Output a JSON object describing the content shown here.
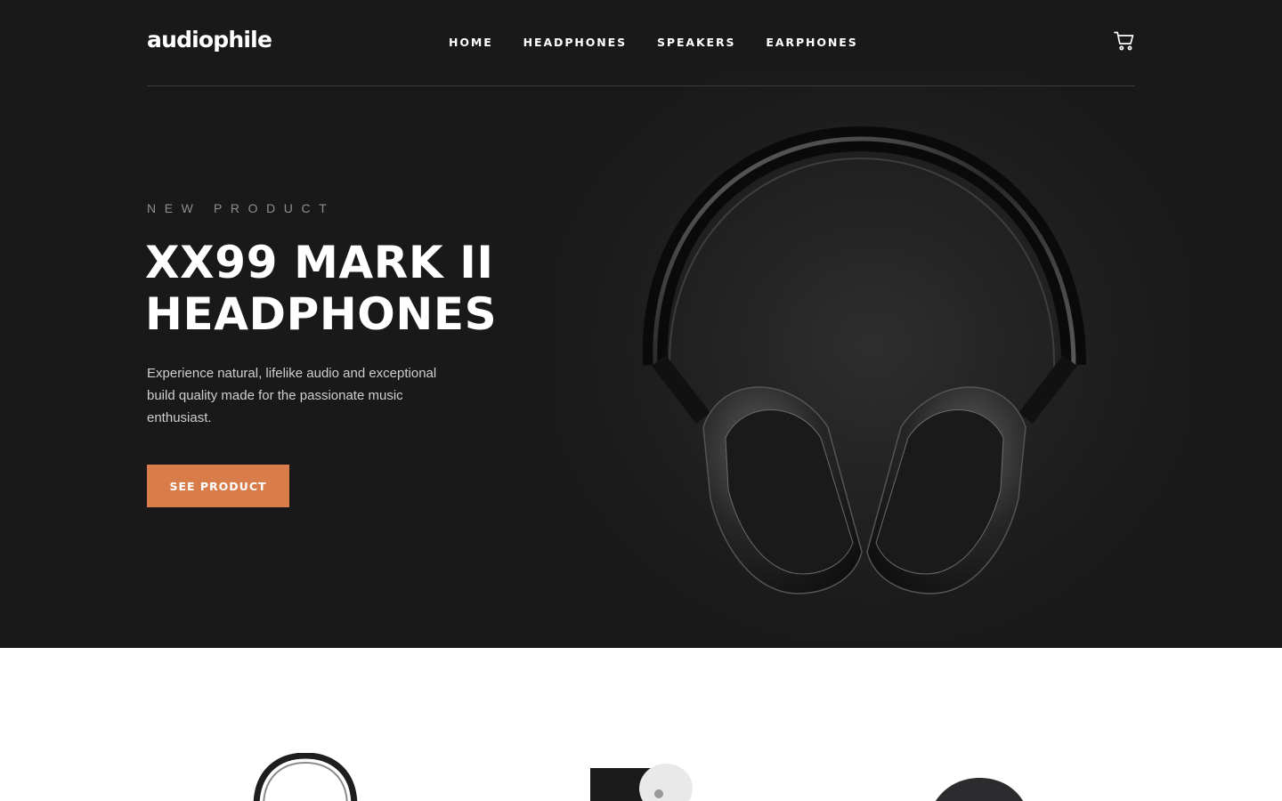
{
  "brand": {
    "logo": "audiophile"
  },
  "nav": {
    "items": [
      {
        "label": "HOME"
      },
      {
        "label": "HEADPHONES"
      },
      {
        "label": "SPEAKERS"
      },
      {
        "label": "EARPHONES"
      }
    ]
  },
  "header": {
    "cart_icon": "cart-icon"
  },
  "hero": {
    "overline": "NEW PRODUCT",
    "title_line1": "XX99 MARK II",
    "title_line2": "HEADPHONES",
    "description": "Experience natural, lifelike audio and exceptional build quality made for the passionate music enthusiast.",
    "cta_label": "SEE PRODUCT",
    "image_icon": "headphones-image"
  },
  "categories": {
    "thumbs": [
      {
        "icon": "headphones-thumbnail"
      },
      {
        "icon": "speaker-thumbnail"
      },
      {
        "icon": "earphones-thumbnail"
      }
    ]
  },
  "colors": {
    "hero_bg": "#191919",
    "accent": "#d87d4a",
    "text_light": "#ffffff",
    "overline": "#8e8e8e"
  }
}
